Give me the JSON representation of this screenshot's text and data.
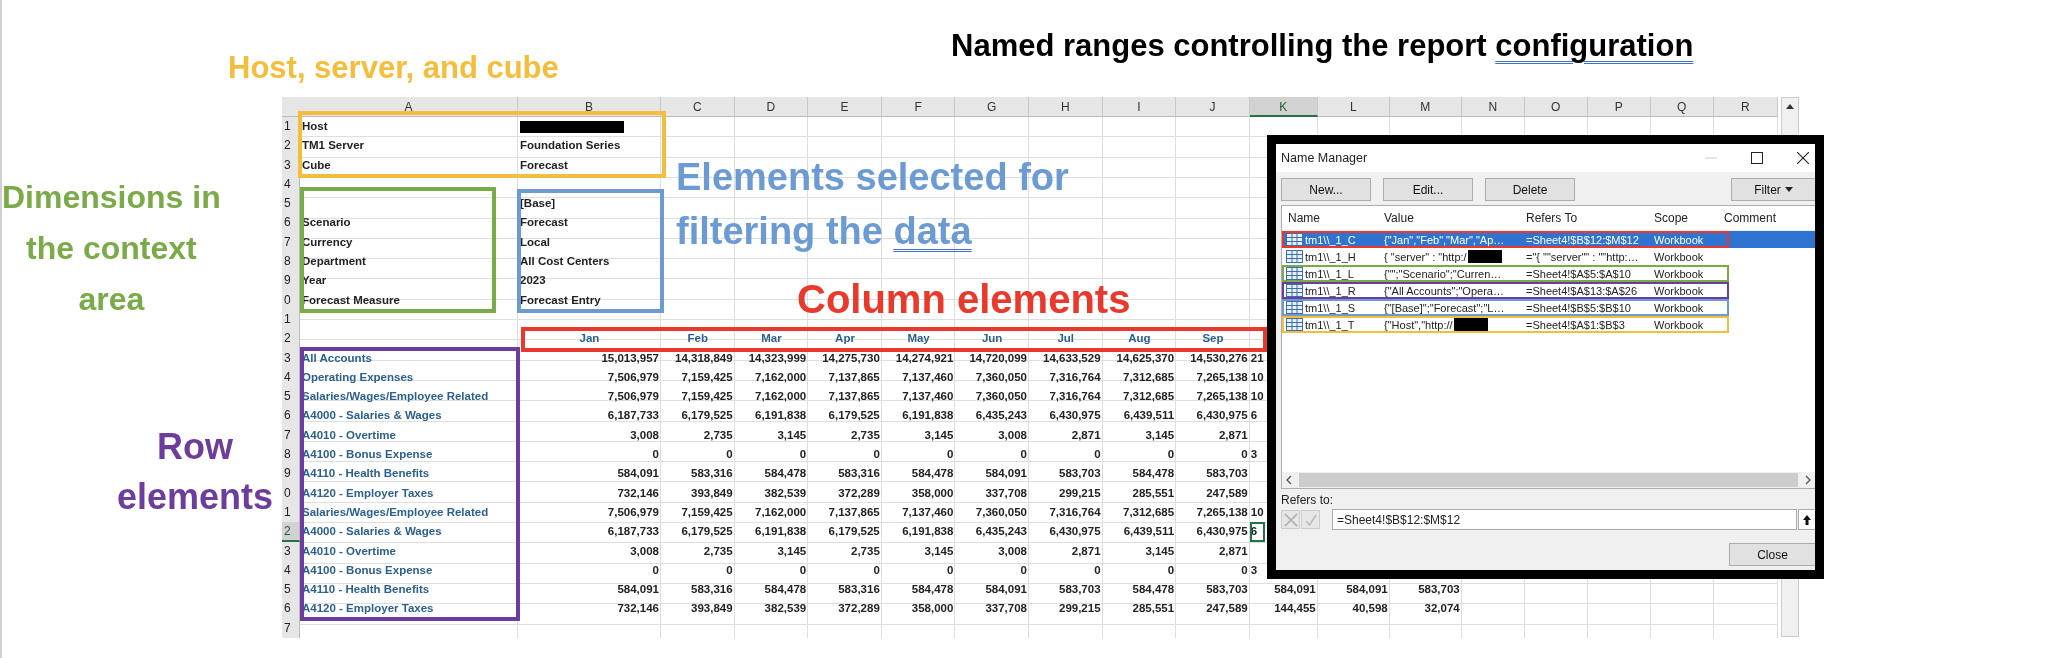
{
  "annotations": [
    {
      "lines": [
        "Host, server, and cube"
      ],
      "color": "#f4be3c",
      "underline_last_word": false
    },
    {
      "lines": [
        "Named ranges controlling the report configuration"
      ],
      "color": "#000000",
      "underline_last_word": true
    },
    {
      "lines": [
        "Dimensions in",
        "the context",
        "area"
      ],
      "color": "#7aab48",
      "underline_last_word": false
    },
    {
      "lines": [
        "Elements selected for",
        "filtering the data"
      ],
      "color": "#6b9bd2",
      "underline_last_word": true
    },
    {
      "lines": [
        "Column elements"
      ],
      "color": "#e8392c",
      "underline_last_word": false
    },
    {
      "lines": [
        "Row",
        "elements"
      ],
      "color": "#6c3d9c",
      "underline_last_word": false
    }
  ],
  "highlight_frames": [
    {
      "color": "#f4be3c"
    },
    {
      "color": "#7aab48"
    },
    {
      "color": "#6b9bd2"
    },
    {
      "color": "#e8392c"
    },
    {
      "color": "#6c3d9c"
    }
  ],
  "sheet": {
    "columns": [
      {
        "label": "A",
        "selected": false
      },
      {
        "label": "B",
        "selected": false
      },
      {
        "label": "C",
        "selected": false
      },
      {
        "label": "D",
        "selected": false
      },
      {
        "label": "E",
        "selected": false
      },
      {
        "label": "F",
        "selected": false
      },
      {
        "label": "G",
        "selected": false
      },
      {
        "label": "H",
        "selected": false
      },
      {
        "label": "I",
        "selected": false
      },
      {
        "label": "J",
        "selected": false
      },
      {
        "label": "K",
        "selected": true
      },
      {
        "label": "L",
        "selected": false
      },
      {
        "label": "M",
        "selected": false
      },
      {
        "label": "N",
        "selected": false
      },
      {
        "label": "O",
        "selected": false
      },
      {
        "label": "P",
        "selected": false
      },
      {
        "label": "Q",
        "selected": false
      },
      {
        "label": "R",
        "selected": false
      }
    ],
    "rows": [
      {
        "number": "1",
        "kind": "config",
        "selected": false,
        "cells": [
          "Host",
          {
            "redacted": true
          }
        ]
      },
      {
        "number": "2",
        "kind": "config",
        "selected": false,
        "cells": [
          "TM1 Server",
          "Foundation Series"
        ]
      },
      {
        "number": "3",
        "kind": "config",
        "selected": false,
        "cells": [
          "Cube",
          "Forecast"
        ]
      },
      {
        "number": "4",
        "kind": "config",
        "selected": false,
        "cells": []
      },
      {
        "number": "5",
        "kind": "config",
        "selected": false,
        "cells": [
          null,
          "[Base]"
        ]
      },
      {
        "number": "6",
        "kind": "config",
        "selected": false,
        "cells": [
          "Scenario",
          "Forecast"
        ]
      },
      {
        "number": "7",
        "kind": "config",
        "selected": false,
        "cells": [
          "Currency",
          "Local"
        ]
      },
      {
        "number": "8",
        "kind": "config",
        "selected": false,
        "cells": [
          "Department",
          "All Cost Centers"
        ]
      },
      {
        "number": "9",
        "kind": "config",
        "selected": false,
        "cells": [
          "Year",
          "2023"
        ]
      },
      {
        "number": "0",
        "kind": "config",
        "selected": false,
        "cells": [
          "Forecast Measure",
          "Forecast Entry"
        ]
      },
      {
        "number": "1",
        "kind": "config",
        "selected": false,
        "cells": []
      },
      {
        "number": "2",
        "kind": "months",
        "selected": false,
        "cells": [
          null,
          "Jan",
          "Feb",
          "Mar",
          "Apr",
          "May",
          "Jun",
          "Jul",
          "Aug",
          "Sep"
        ]
      },
      {
        "number": "3",
        "kind": "clipped",
        "selected": false,
        "cells": [
          "All Accounts",
          "15,013,957",
          "14,318,849",
          "14,323,999",
          "14,275,730",
          "14,274,921",
          "14,720,099",
          "14,633,529",
          "14,625,370",
          "14,530,276",
          "21"
        ]
      },
      {
        "number": "4",
        "kind": "clipped",
        "selected": false,
        "cells": [
          "Operating Expenses",
          "7,506,979",
          "7,159,425",
          "7,162,000",
          "7,137,865",
          "7,137,460",
          "7,360,050",
          "7,316,764",
          "7,312,685",
          "7,265,138",
          "10"
        ]
      },
      {
        "number": "5",
        "kind": "clipped",
        "selected": false,
        "cells": [
          "Salaries/Wages/Employee Related",
          "7,506,979",
          "7,159,425",
          "7,162,000",
          "7,137,865",
          "7,137,460",
          "7,360,050",
          "7,316,764",
          "7,312,685",
          "7,265,138",
          "10"
        ]
      },
      {
        "number": "6",
        "kind": "clipped",
        "selected": false,
        "cells": [
          "A4000 - Salaries & Wages",
          "6,187,733",
          "6,179,525",
          "6,191,838",
          "6,179,525",
          "6,191,838",
          "6,435,243",
          "6,430,975",
          "6,439,511",
          "6,430,975",
          "6"
        ]
      },
      {
        "number": "7",
        "kind": "clipped",
        "selected": false,
        "cells": [
          "A4010 - Overtime",
          "3,008",
          "2,735",
          "3,145",
          "2,735",
          "3,145",
          "3,008",
          "2,871",
          "3,145",
          "2,871"
        ]
      },
      {
        "number": "8",
        "kind": "clipped",
        "selected": false,
        "cells": [
          "A4100 - Bonus Expense",
          "0",
          "0",
          "0",
          "0",
          "0",
          "0",
          "0",
          "0",
          "0",
          "3"
        ]
      },
      {
        "number": "9",
        "kind": "clipped",
        "selected": false,
        "cells": [
          "A4110 - Health Benefits",
          "584,091",
          "583,316",
          "584,478",
          "583,316",
          "584,478",
          "584,091",
          "583,703",
          "584,478",
          "583,703"
        ]
      },
      {
        "number": "0",
        "kind": "clipped",
        "selected": false,
        "cells": [
          "A4120 - Employer Taxes",
          "732,146",
          "393,849",
          "382,539",
          "372,289",
          "358,000",
          "337,708",
          "299,215",
          "285,551",
          "247,589"
        ]
      },
      {
        "number": "1",
        "kind": "clipped",
        "selected": false,
        "cells": [
          "Salaries/Wages/Employee Related",
          "7,506,979",
          "7,159,425",
          "7,162,000",
          "7,137,865",
          "7,137,460",
          "7,360,050",
          "7,316,764",
          "7,312,685",
          "7,265,138",
          "10"
        ]
      },
      {
        "number": "2",
        "kind": "clipped",
        "selected": true,
        "cells": [
          "A4000 - Salaries & Wages",
          "6,187,733",
          "6,179,525",
          "6,191,838",
          "6,179,525",
          "6,191,838",
          "6,435,243",
          "6,430,975",
          "6,439,511",
          "6,430,975",
          "6"
        ]
      },
      {
        "number": "3",
        "kind": "clipped",
        "selected": false,
        "cells": [
          "A4010 - Overtime",
          "3,008",
          "2,735",
          "3,145",
          "2,735",
          "3,145",
          "3,008",
          "2,871",
          "3,145",
          "2,871"
        ]
      },
      {
        "number": "4",
        "kind": "clipped",
        "selected": false,
        "cells": [
          "A4100 - Bonus Expense",
          "0",
          "0",
          "0",
          "0",
          "0",
          "0",
          "0",
          "0",
          "0",
          "3"
        ]
      },
      {
        "number": "5",
        "kind": "data",
        "selected": false,
        "cells": [
          "A4110 - Health Benefits",
          "584,091",
          "583,316",
          "584,478",
          "583,316",
          "584,478",
          "584,091",
          "583,703",
          "584,478",
          "583,703",
          "584,091",
          "584,091",
          "583,703"
        ]
      },
      {
        "number": "6",
        "kind": "data",
        "selected": false,
        "cells": [
          "A4120 - Employer Taxes",
          "732,146",
          "393,849",
          "382,539",
          "372,289",
          "358,000",
          "337,708",
          "299,215",
          "285,551",
          "247,589",
          "144,455",
          "40,598",
          "32,074"
        ]
      },
      {
        "number": "7",
        "kind": "data",
        "selected": false,
        "cells": []
      }
    ]
  },
  "dialog": {
    "title": "Name Manager",
    "buttons": [
      "New...",
      "Edit...",
      "Delete"
    ],
    "filter_button": "Filter",
    "columns": [
      "Name",
      "Value",
      "Refers To",
      "Scope",
      "Comment"
    ],
    "items": [
      {
        "name": "tm1\\\\_1_C",
        "value": "{\"Jan\",\"Feb\",\"Mar\",\"Ap…",
        "value_redacted": false,
        "refers_to": "=Sheet4!$B$12:$M$12",
        "scope": "Workbook",
        "selected": true,
        "color": "#e8392c"
      },
      {
        "name": "tm1\\\\_1_H",
        "value": "{ \"server\" : \"http:/",
        "value_redacted": true,
        "refers_to": "=\"{ \"\"server\"\" : \"\"http:…",
        "scope": "Workbook",
        "selected": false
      },
      {
        "name": "tm1\\\\_1_L",
        "value": "{\"\";\"Scenario\";\"Curren…",
        "value_redacted": false,
        "refers_to": "=Sheet4!$A$5:$A$10",
        "scope": "Workbook",
        "selected": false,
        "color": "#7aab48"
      },
      {
        "name": "tm1\\\\_1_R",
        "value": "{\"All Accounts\";\"Opera…",
        "value_redacted": false,
        "refers_to": "=Sheet4!$A$13:$A$26",
        "scope": "Workbook",
        "selected": false,
        "color": "#6c3d9c"
      },
      {
        "name": "tm1\\\\_1_S",
        "value": "{\"[Base]\";\"Forecast\";\"L…",
        "value_redacted": false,
        "refers_to": "=Sheet4!$B$5:$B$10",
        "scope": "Workbook",
        "selected": false,
        "color": "#6b9bd2"
      },
      {
        "name": "tm1\\\\_1_T",
        "value": "{\"Host\",\"http://",
        "value_redacted": true,
        "refers_to": "=Sheet4!$A$1:$B$3",
        "scope": "Workbook",
        "selected": false,
        "color": "#f4be3c"
      }
    ],
    "refers_label": "Refers to:",
    "refers_value": "=Sheet4!$B$12:$M$12",
    "close_button": "Close"
  }
}
